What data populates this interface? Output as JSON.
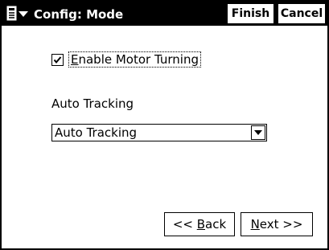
{
  "titlebar": {
    "title": "Config: Mode",
    "finish_label": "Finish",
    "cancel_label": "Cancel",
    "menu_icon": "start-menu-icon"
  },
  "mode": {
    "enable_motor_turning": {
      "label_mnemonic": "E",
      "label_rest": "nable Motor Turning",
      "checked": true
    },
    "auto_tracking": {
      "section_label": "Auto Tracking",
      "selected_value": "Auto Tracking"
    }
  },
  "nav": {
    "back_prefix": "<< ",
    "back_mnemonic": "B",
    "back_rest": "ack",
    "next_mnemonic": "N",
    "next_rest": "ext >>"
  },
  "colors": {
    "titlebar_bg": "#000000",
    "title_text": "#ffffff",
    "background": "#ffffff"
  }
}
